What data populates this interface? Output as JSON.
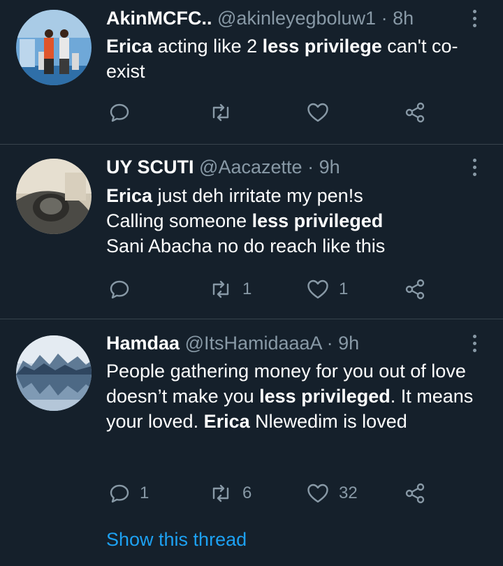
{
  "tweets": [
    {
      "name": "AkinMCFC..",
      "handle": "@akinleyegboluw1",
      "dot": "·",
      "time": "8h",
      "body": [
        {
          "text": "Erica",
          "bold": true
        },
        {
          "text": " acting like 2 ",
          "bold": false
        },
        {
          "text": "less privilege",
          "bold": true
        },
        {
          "text": " can't co-exist",
          "bold": false
        }
      ],
      "reply_count": "",
      "retweet_count": "",
      "like_count": ""
    },
    {
      "name": "UY SCUTI",
      "handle": "@Aacazette",
      "dot": "·",
      "time": "9h",
      "body_lines": [
        [
          {
            "text": "Erica",
            "bold": true
          },
          {
            "text": " just deh irritate my pen!s",
            "bold": false
          }
        ],
        [
          {
            "text": "Calling someone ",
            "bold": false
          },
          {
            "text": "less privileged",
            "bold": true
          }
        ],
        [
          {
            "text": "Sani Abacha no do reach like this",
            "bold": false
          }
        ]
      ],
      "reply_count": "",
      "retweet_count": "1",
      "like_count": "1"
    },
    {
      "name": "Hamdaa",
      "handle": "@ItsHamidaaaA",
      "dot": "·",
      "time": "9h",
      "body": [
        {
          "text": "People gathering money for you out of love doesn’t make you ",
          "bold": false
        },
        {
          "text": "less privileged",
          "bold": true
        },
        {
          "text": ". It means your loved. ",
          "bold": false
        },
        {
          "text": "Erica",
          "bold": true
        },
        {
          "text": " Nlewedim is loved",
          "bold": false
        }
      ],
      "reply_count": "1",
      "retweet_count": "6",
      "like_count": "32"
    }
  ],
  "show_thread": "Show this thread",
  "colors": {
    "background": "#15202b",
    "divider": "#38444d",
    "secondary_text": "#8899a6",
    "link": "#1da1f2"
  },
  "icons": [
    "reply-icon",
    "retweet-icon",
    "like-icon",
    "share-icon",
    "more-options-icon"
  ]
}
